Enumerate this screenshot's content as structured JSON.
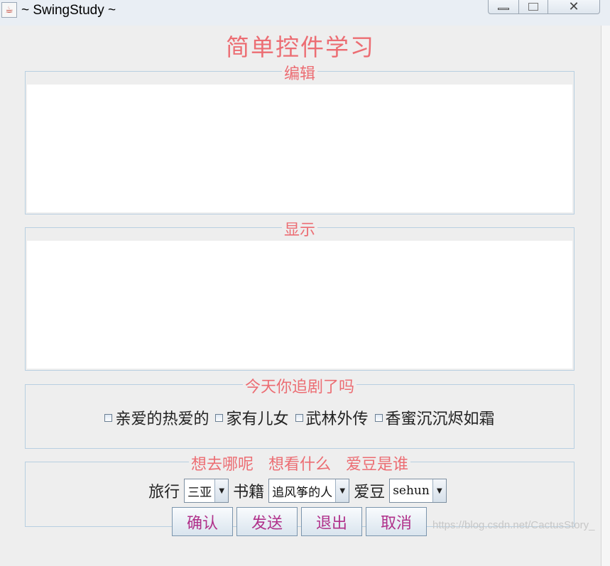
{
  "window": {
    "title": "~ SwingStudy ~",
    "icon": "java-cup-icon",
    "controls": {
      "close_glyph": "✕"
    }
  },
  "heading": "简单控件学习",
  "edit_group": {
    "legend": "编辑",
    "value": ""
  },
  "display_group": {
    "legend": "显示",
    "value": ""
  },
  "drama_group": {
    "legend": "今天你追剧了吗",
    "options": [
      {
        "label": "亲爱的热爱的",
        "checked": false
      },
      {
        "label": "家有儿女",
        "checked": false
      },
      {
        "label": "武林外传",
        "checked": false
      },
      {
        "label": "香蜜沉沉烬如霜",
        "checked": false
      }
    ]
  },
  "choose_group": {
    "legend": "想去哪呢   想看什么   爱豆是谁",
    "selects": [
      {
        "label": "旅行",
        "value": "三亚"
      },
      {
        "label": "书籍",
        "value": "追风筝的人"
      },
      {
        "label": "爱豆",
        "value": "sehun"
      }
    ]
  },
  "buttons": [
    "确认",
    "发送",
    "退出",
    "取消"
  ],
  "watermark": "https://blog.csdn.net/CactusStory_",
  "colors": {
    "heading": "#ec6d73",
    "legend": "#ec6d73",
    "button_text": "#b0308a",
    "panel_bg": "#eeeeee",
    "group_border": "#b8cfe1"
  }
}
